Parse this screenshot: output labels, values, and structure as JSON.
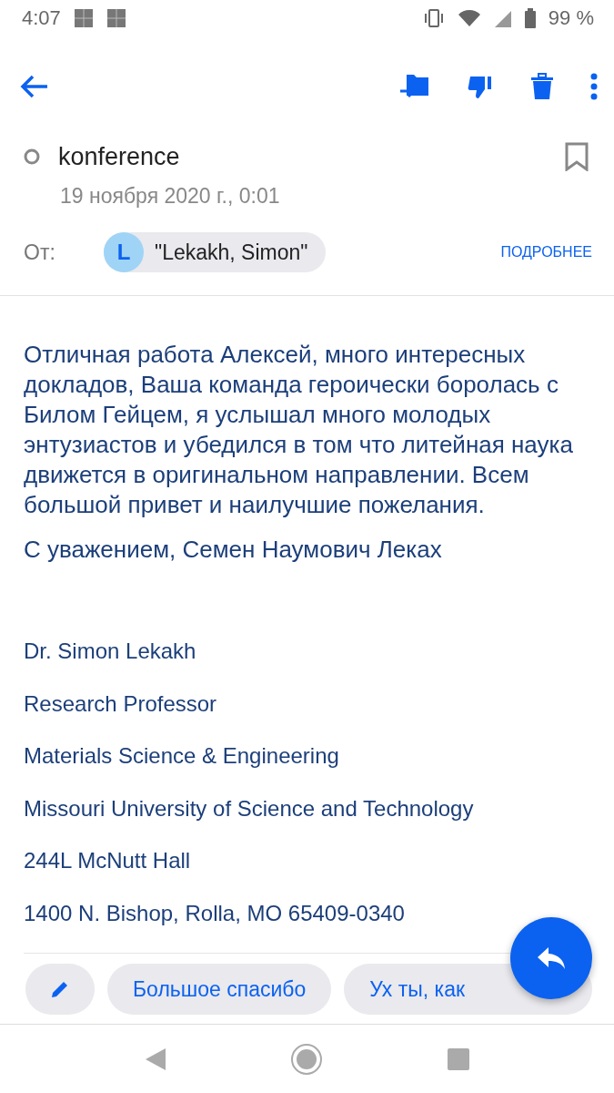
{
  "status_bar": {
    "time": "4:07",
    "battery": "99 %"
  },
  "subject": "konference",
  "bookmarked": false,
  "date": "19 ноября 2020 г., 0:01",
  "from": {
    "label": "От:",
    "avatar_letter": "L",
    "name": "\"Lekakh, Simon\"",
    "details_link": "ПОДРОБНЕЕ"
  },
  "body": [
    "Отличная работа Алексей, много интересных докладов, Ваша команда героически боролась с Билом Гейцем, я услышал много молодых энтузиастов и убедился в том что литейная наука движется в оригинальном направлении. Всем большой привет и наилучшие пожелания.",
    "С уважением, Семен Наумович Леках"
  ],
  "signature": [
    "Dr. Simon Lekakh",
    "Research Professor",
    "Materials Science & Engineering",
    "Missouri University of Science and Technology",
    "244L McNutt Hall",
    "1400 N. Bishop, Rolla, MO 65409-0340"
  ],
  "smart_replies": [
    "Большое спасибо",
    "Ух ты, как"
  ]
}
